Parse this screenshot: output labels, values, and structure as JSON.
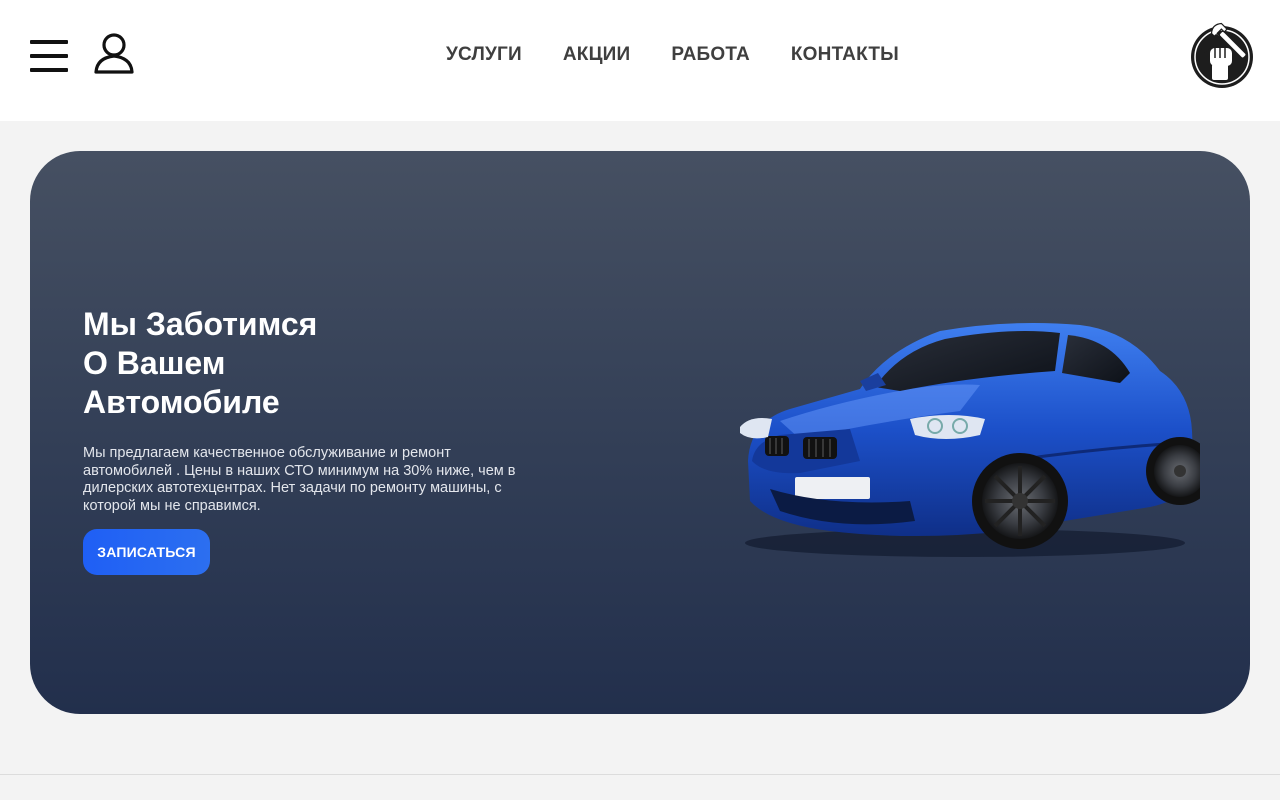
{
  "header": {
    "nav": [
      {
        "label": "УСЛУГИ"
      },
      {
        "label": "АКЦИИ"
      },
      {
        "label": "РАБОТА"
      },
      {
        "label": "КОНТАКТЫ"
      }
    ]
  },
  "hero": {
    "title_lines": [
      "Мы Заботимся",
      "О Вашем",
      "Автомобиле"
    ],
    "description": "Мы предлагаем качественное обслуживание и ремонт автомобилей . Цены в наших СТО минимум на 30% ниже, чем в дилерских автотехцентрах. Нет задачи по ремонту машины, с которой мы не справимся.",
    "cta_label": "ЗАПИСАТЬСЯ"
  },
  "icons": {
    "menu": "hamburger-menu-icon",
    "user": "user-icon",
    "logo": "fist-wrench-logo",
    "car": "blue-sports-car-image"
  },
  "colors": {
    "header_bg": "#ffffff",
    "page_bg": "#f3f3f3",
    "hero_top": "#465062",
    "hero_bottom": "#222f4c",
    "accent": "#1f5ff5",
    "nav_text": "#3f3f3f"
  }
}
